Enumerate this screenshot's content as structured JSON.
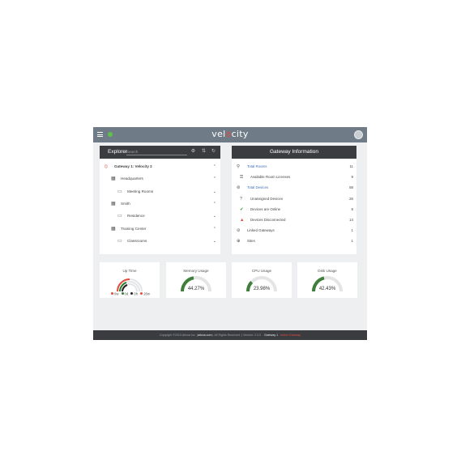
{
  "app": {
    "brand_prefix": "vel",
    "brand_i": "o",
    "brand_suffix": "city"
  },
  "explorer": {
    "title": "Explorer",
    "search_placeholder": "Search",
    "tree": [
      {
        "label": "Gateway 1: Velocity 2",
        "icon": "no-entry-icon",
        "bold": true,
        "chevron": "up"
      },
      {
        "label": "Headquarters",
        "icon": "building-icon",
        "chevron": "up"
      },
      {
        "label": "Meeting Rooms",
        "icon": "room-icon",
        "chevron": "down"
      },
      {
        "label": "Smith",
        "icon": "building-icon",
        "chevron": "up"
      },
      {
        "label": "Residence",
        "icon": "room-icon",
        "chevron": "down"
      },
      {
        "label": "Training Center",
        "icon": "building-icon",
        "chevron": "up"
      },
      {
        "label": "Classrooms",
        "icon": "room-icon",
        "chevron": "down"
      }
    ]
  },
  "gateway_info": {
    "title": "Gateway Information",
    "rows": [
      {
        "label": "Total Rooms",
        "value": "11",
        "icon": "location-pin-icon",
        "blue": true
      },
      {
        "label": "Available Room Licenses",
        "value": "9",
        "icon": "key-icon"
      },
      {
        "label": "Total Devices",
        "value": "58",
        "icon": "devices-icon",
        "blue": true
      },
      {
        "label": "Unassigned Devices",
        "value": "26",
        "icon": "question-circle-icon"
      },
      {
        "label": "Devices are Online",
        "value": "8",
        "icon": "check-circle-icon"
      },
      {
        "label": "Devices Disconnected",
        "value": "14",
        "icon": "warning-triangle-icon"
      },
      {
        "label": "Linked Gateways",
        "value": "1",
        "icon": "link-icon"
      },
      {
        "label": "Sites",
        "value": "1",
        "icon": "globe-icon"
      }
    ]
  },
  "cards": {
    "uptime": {
      "title": "Up Time",
      "legend": [
        "0w",
        "0d",
        "0h",
        "26m"
      ],
      "legend_colors": [
        "#e24b3b",
        "#2e7d32",
        "#222222",
        "#e24b3b"
      ]
    },
    "memory": {
      "title": "Memory Usage",
      "percent": "44.27%",
      "fraction": 0.4427
    },
    "cpu": {
      "title": "CPU Usage",
      "percent": "23.98%",
      "fraction": 0.2398
    },
    "disk": {
      "title": "Disk Usage",
      "percent": "42.43%",
      "fraction": 0.4243
    }
  },
  "footer": {
    "copyright": "Copyright ©2019 Atlona Inc. (",
    "site": "atlona.com",
    "rights": "). All Rights Reserved. | Version: 2.3.0",
    "gateway_label": "Gateway 1",
    "active_label": "Active Gateway"
  },
  "colors": {
    "accent_red": "#e24b3b",
    "gauge_green": "#3f7f3a",
    "gauge_track": "#e3e5e7",
    "header_dark": "#3a3c40",
    "topbar": "#6f7b87"
  }
}
